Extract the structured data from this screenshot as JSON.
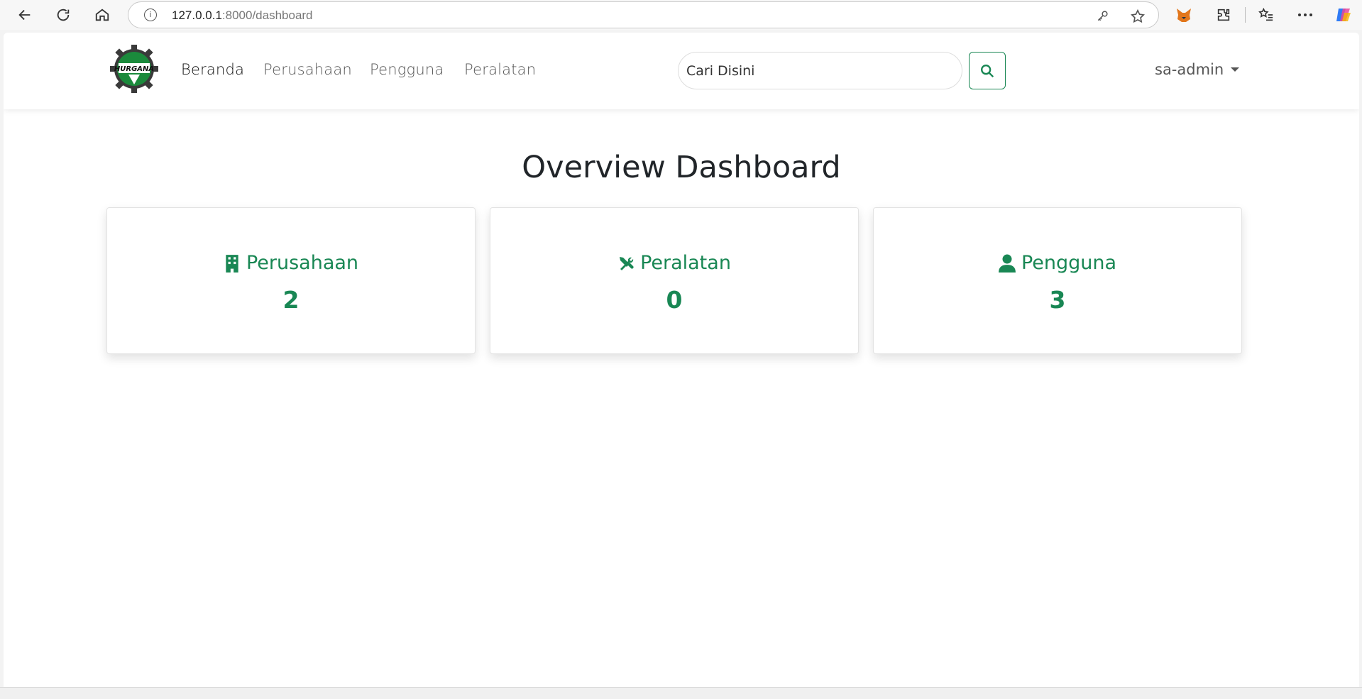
{
  "browser": {
    "url_host": "127.0.0.1",
    "url_path": ":8000/dashboard"
  },
  "navbar": {
    "logo_text": "HURGANA",
    "links": [
      "Beranda",
      "Perusahaan",
      "Pengguna",
      "Peralatan"
    ],
    "search_placeholder": "Cari Disini",
    "user": "sa-admin"
  },
  "main": {
    "title": "Overview Dashboard",
    "cards": [
      {
        "label": "Perusahaan",
        "value": "2",
        "icon": "building-icon"
      },
      {
        "label": "Peralatan",
        "value": "0",
        "icon": "tools-icon"
      },
      {
        "label": "Pengguna",
        "value": "3",
        "icon": "user-icon"
      }
    ]
  },
  "colors": {
    "accent": "#198754",
    "text": "#212529"
  }
}
